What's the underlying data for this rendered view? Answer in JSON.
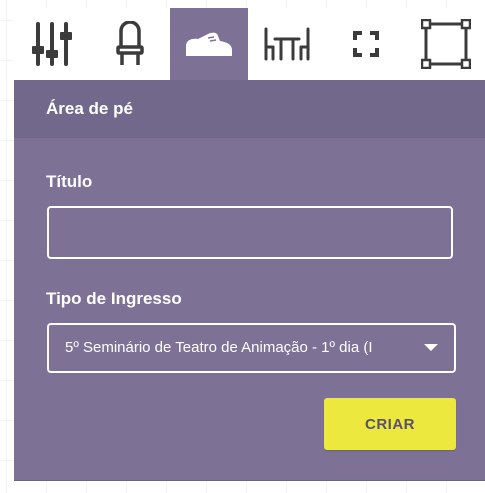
{
  "toolbar": {
    "tools": [
      {
        "icon": "sliders-icon"
      },
      {
        "icon": "chair-icon"
      },
      {
        "icon": "shoe-icon",
        "active": true
      },
      {
        "icon": "table-chairs-icon"
      },
      {
        "icon": "focus-frame-icon"
      },
      {
        "icon": "selection-box-icon"
      }
    ]
  },
  "panel": {
    "title": "Área de pé",
    "titulo_label": "Título",
    "titulo_value": "",
    "tipo_label": "Tipo de Ingresso",
    "tipo_selected": "5º Seminário de Teatro de Animação - 1º dia (I",
    "criar_label": "CRIAR"
  },
  "colors": {
    "panel_bg": "#7d7296",
    "header_bg": "#72688b",
    "button_bg": "#ede83e",
    "icon_dark": "#3b3b3b"
  }
}
